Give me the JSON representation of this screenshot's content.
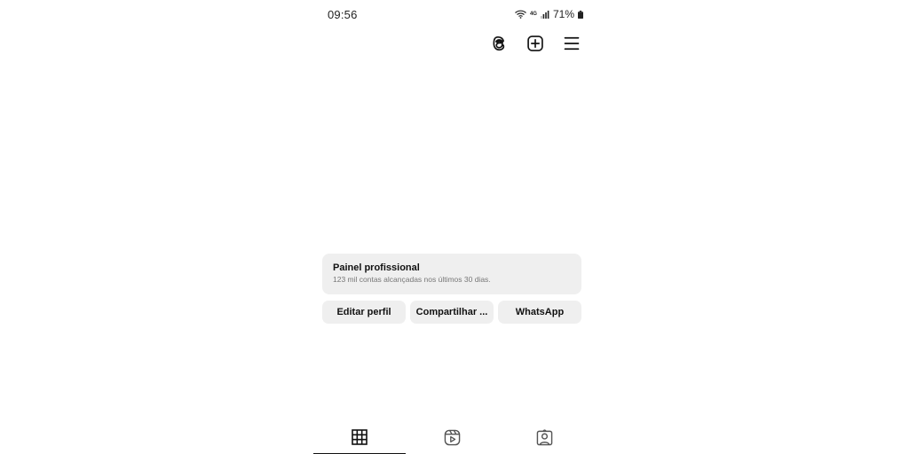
{
  "status_bar": {
    "time": "09:56",
    "network_label": "4G",
    "battery": "71%"
  },
  "header": {
    "icons": [
      "threads-icon",
      "plus-square-icon",
      "menu-icon"
    ]
  },
  "panel": {
    "title": "Painel profissional",
    "subtitle": "123 mil contas alcançadas nos últimos 30 dias."
  },
  "actions": {
    "edit_profile": "Editar perfil",
    "share": "Compartilhar ...",
    "whatsapp": "WhatsApp"
  },
  "tabs": {
    "items": [
      "grid-icon",
      "reels-icon",
      "tagged-icon"
    ],
    "active": "grid-icon"
  }
}
